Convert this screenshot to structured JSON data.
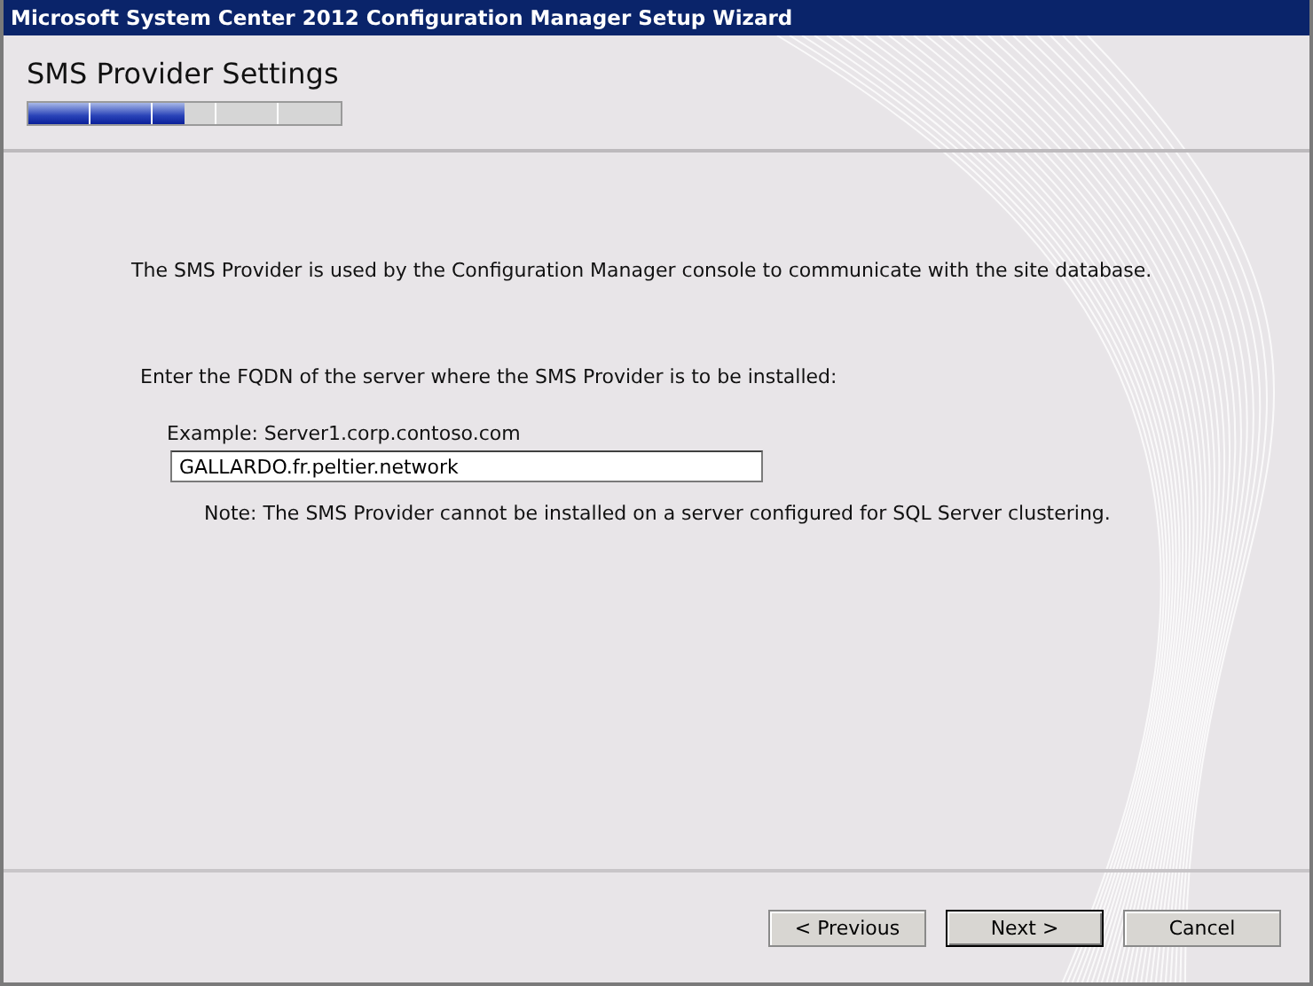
{
  "window": {
    "title": "Microsoft System Center 2012 Configuration Manager Setup Wizard"
  },
  "header": {
    "title": "SMS Provider Settings",
    "progress": {
      "level": 0.5
    }
  },
  "content": {
    "description": "The SMS Provider is used by the Configuration Manager console to communicate with the site database.",
    "prompt": "Enter the FQDN of the server where the SMS Provider is to be installed:",
    "example": "Example: Server1.corp.contoso.com",
    "server_field": {
      "value": "GALLARDO.fr.peltier.network"
    },
    "note": "Note: The SMS Provider cannot be installed on a server configured for SQL Server clustering."
  },
  "buttons": [
    {
      "label": "< Previous",
      "default": false
    },
    {
      "label": "Next >",
      "default": true
    },
    {
      "label": "Cancel",
      "default": false
    }
  ]
}
